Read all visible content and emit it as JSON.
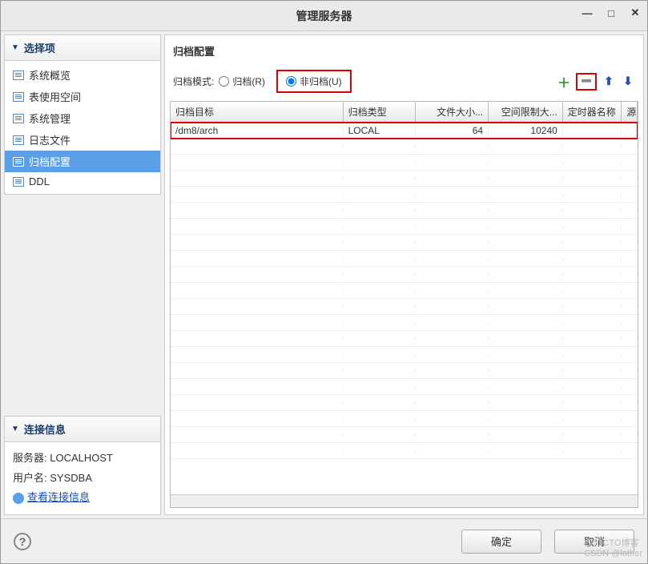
{
  "window": {
    "title": "管理服务器"
  },
  "sidebar": {
    "select_header": "选择项",
    "items": [
      {
        "label": "系统概览"
      },
      {
        "label": "表使用空间"
      },
      {
        "label": "系统管理"
      },
      {
        "label": "日志文件"
      },
      {
        "label": "归档配置"
      },
      {
        "label": "DDL"
      }
    ],
    "conn_header": "连接信息",
    "server_label": "服务器:",
    "server_value": "LOCALHOST",
    "user_label": "用户名:",
    "user_value": "SYSDBA",
    "link": "查看连接信息"
  },
  "main": {
    "title": "归档配置",
    "mode_label": "归档模式:",
    "opt_archive": "归档(R)",
    "opt_nonarchive": "非归档(U)",
    "columns": {
      "c0": "归档目标",
      "c1": "归档类型",
      "c2": "文件大小...",
      "c3": "空间限制大...",
      "c4": "定时器名称",
      "c5": "源"
    },
    "rows": [
      {
        "target": "/dm8/arch",
        "type": "LOCAL",
        "file_size": "64",
        "space_limit": "10240",
        "timer": "",
        "src": ""
      }
    ]
  },
  "footer": {
    "ok": "确定",
    "cancel": "取消"
  },
  "watermark": {
    "a": "@51CTO博客",
    "b": "CSDN @lother"
  }
}
